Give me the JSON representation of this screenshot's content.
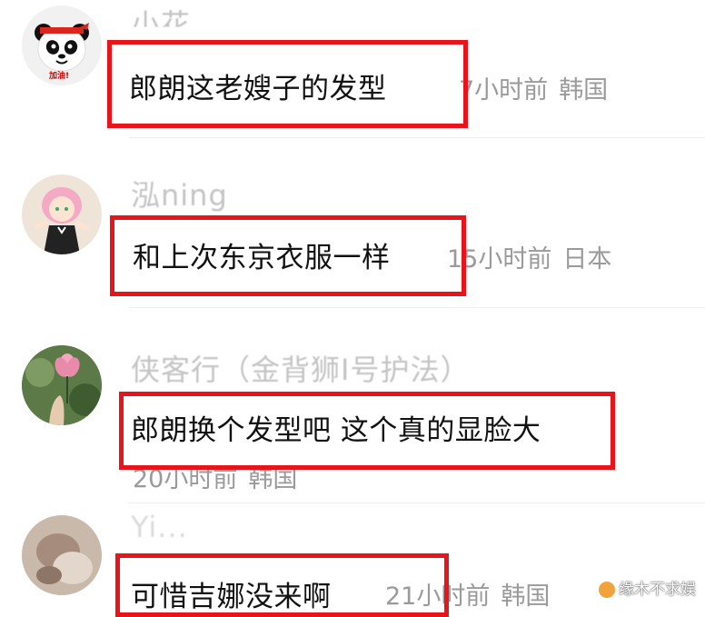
{
  "comments": [
    {
      "username": "小花",
      "text": "郎朗这老嫂子的发型",
      "time": "7小时前",
      "location": "韩国",
      "avatar": "panda-avatar",
      "avatar_badge": "加油!"
    },
    {
      "username": "泓ning",
      "text": "和上次东京衣服一样",
      "time": "15小时前",
      "location": "日本",
      "avatar": "anime-girl-avatar"
    },
    {
      "username": "侠客行（金背狮I号护法）",
      "text": "郎朗换个发型吧 这个真的显脸大",
      "time": "20小时前",
      "location": "韩国",
      "avatar": "lotus-flower-avatar"
    },
    {
      "username": "Yi...",
      "text": "可惜吉娜没来啊",
      "time": "21小时前",
      "location": "韩国",
      "avatar": "blurred-photo-avatar"
    }
  ],
  "watermark": "缘木不求娱",
  "colors": {
    "highlight": "#e8141c",
    "meta": "#9a9a9a",
    "username": "#c4c4c4"
  }
}
